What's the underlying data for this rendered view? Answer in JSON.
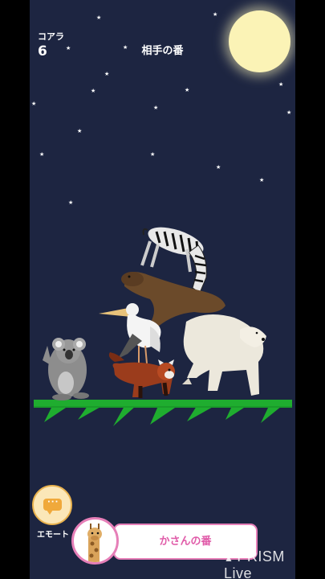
{
  "hud": {
    "player_label": "コアラ",
    "player_score": "6",
    "turn_status": "相手の番"
  },
  "animals": [
    "zebra",
    "sea-lion",
    "pelican",
    "polar-bear",
    "koala",
    "red-panda"
  ],
  "controls": {
    "emote_label": "エモート",
    "turn_banner": "かさんの番"
  },
  "watermark": "PRISM Live",
  "colors": {
    "sky": "#1d2541",
    "grass": "#1fad2f",
    "accent_pink": "#e67fb8",
    "moon": "#fbf3b6"
  }
}
